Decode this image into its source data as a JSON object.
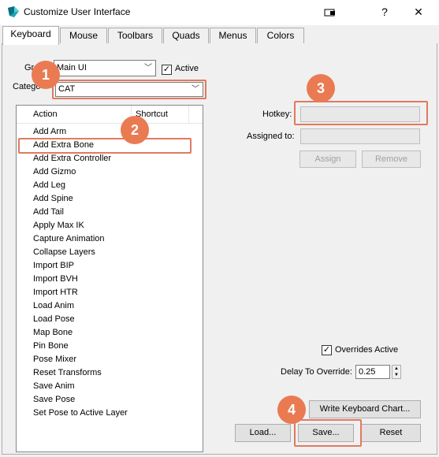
{
  "window": {
    "title": "Customize User Interface",
    "help_glyph": "?",
    "close_glyph": "✕"
  },
  "tabs": [
    {
      "label": "Keyboard",
      "active": true
    },
    {
      "label": "Mouse"
    },
    {
      "label": "Toolbars"
    },
    {
      "label": "Quads"
    },
    {
      "label": "Menus"
    },
    {
      "label": "Colors"
    }
  ],
  "group": {
    "label": "Gr",
    "value": "Main UI"
  },
  "active_checkbox": {
    "label": "Active",
    "checked": true,
    "mark": "✓"
  },
  "category": {
    "label": "Catego",
    "value": "CAT"
  },
  "list": {
    "headers": {
      "action": "Action",
      "shortcut": "Shortcut"
    },
    "actions": [
      "Add Arm",
      "Add Extra Bone",
      "Add Extra Controller",
      "Add Gizmo",
      "Add Leg",
      "Add Spine",
      "Add Tail",
      "Apply Max IK",
      "Capture Animation",
      "Collapse Layers",
      "Import BIP",
      "Import BVH",
      "Import HTR",
      "Load Anim",
      "Load Pose",
      "Map Bone",
      "Pin Bone",
      "Pose Mixer",
      "Reset Transforms",
      "Save Anim",
      "Save Pose",
      "Set Pose to Active Layer"
    ]
  },
  "hotkey": {
    "label": "Hotkey:",
    "value": ""
  },
  "assigned_to": {
    "label": "Assigned to:",
    "value": ""
  },
  "buttons": {
    "assign": "Assign",
    "remove": "Remove",
    "write_chart": "Write Keyboard Chart...",
    "load": "Load...",
    "save": "Save...",
    "reset": "Reset"
  },
  "overrides": {
    "label": "Overrides Active",
    "checked": true,
    "mark": "✓"
  },
  "delay": {
    "label": "Delay To Override:",
    "value": "0.25",
    "up": "▲",
    "down": "▼"
  },
  "badges": [
    "1",
    "2",
    "3",
    "4"
  ],
  "colors": {
    "highlight": "#e07a5f",
    "badge": "#ea7a52"
  }
}
